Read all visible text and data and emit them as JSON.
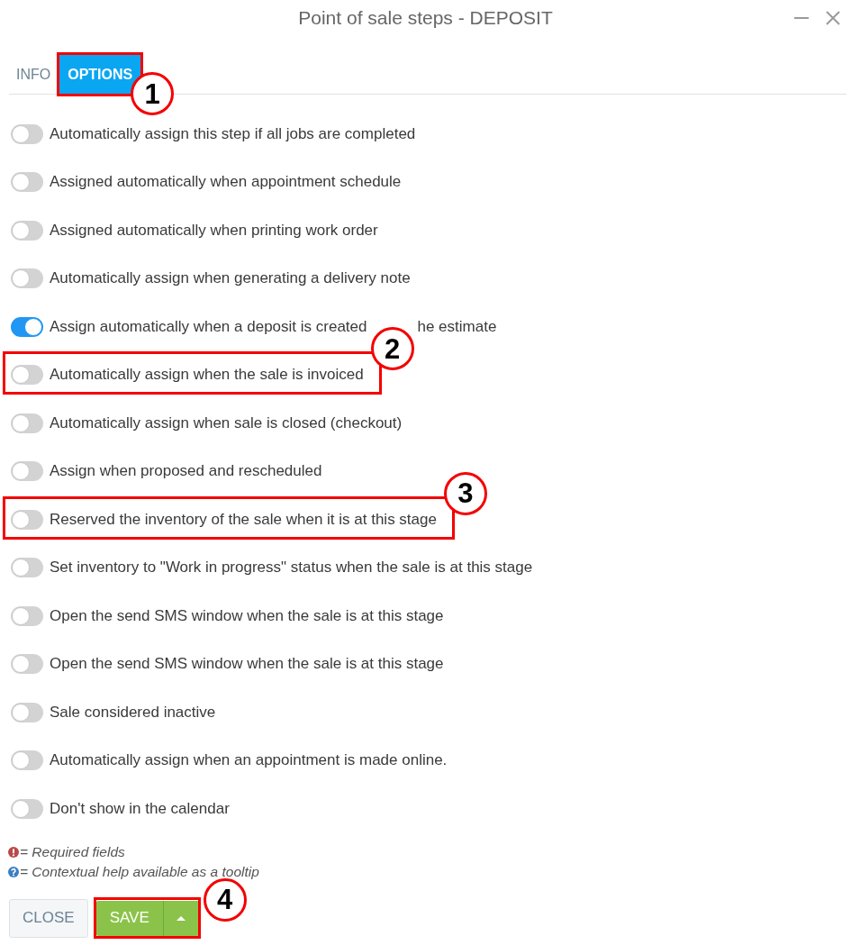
{
  "window": {
    "title": "Point of sale steps - DEPOSIT"
  },
  "tabs": [
    {
      "label": "INFO",
      "selected": false
    },
    {
      "label": "OPTIONS",
      "selected": true,
      "callout": "1"
    }
  ],
  "options": [
    {
      "label": "Automatically assign this step if all jobs are completed",
      "on": false
    },
    {
      "label": "Assigned automatically when appointment schedule",
      "on": false
    },
    {
      "label": "Assigned automatically when printing work order",
      "on": false
    },
    {
      "label": "Automatically assign when generating a delivery note",
      "on": false
    },
    {
      "label": "Assign automatically when a deposit is created",
      "label_tail": "he estimate",
      "on": true
    },
    {
      "label": "Automatically assign when the sale is invoiced",
      "on": false,
      "callout": "2"
    },
    {
      "label": "Automatically assign when sale is closed (checkout)",
      "on": false
    },
    {
      "label": "Assign when proposed and rescheduled",
      "on": false
    },
    {
      "label": "Reserved the inventory of the sale when it is at this stage",
      "on": false,
      "callout": "3"
    },
    {
      "label": "Set inventory to \"Work in progress\" status when the sale is at this stage",
      "on": false
    },
    {
      "label": "Open the send SMS window when the sale is at this stage",
      "on": false
    },
    {
      "label": "Open the send SMS window when the sale is at this stage",
      "on": false
    },
    {
      "label": "Sale considered inactive",
      "on": false
    },
    {
      "label": "Automatically assign when an appointment is made online.",
      "on": false
    },
    {
      "label": "Don't show in the calendar",
      "on": false
    }
  ],
  "legend": [
    {
      "kind": "required",
      "text": "= Required fields"
    },
    {
      "kind": "help",
      "text": "= Contextual help available as a tooltip"
    }
  ],
  "buttons": [
    {
      "kind": "close",
      "label": "CLOSE"
    },
    {
      "kind": "save",
      "label": "SAVE",
      "menu": true,
      "callout": "4"
    }
  ]
}
